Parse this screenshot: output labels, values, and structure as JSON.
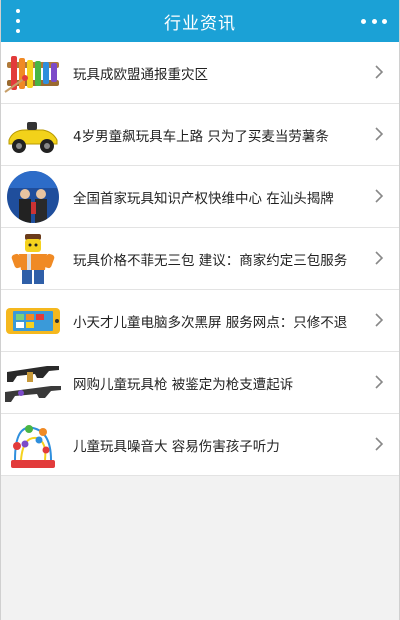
{
  "header": {
    "title": "行业资讯"
  },
  "icons": {
    "left": "vertical-dots-menu-icon",
    "right": "more-horizontal-icon",
    "chevron": "chevron-right-icon"
  },
  "colors": {
    "header_bg": "#1ba1d6",
    "page_bg": "#f2f2f2"
  },
  "news": {
    "items": [
      {
        "title": "玩具成欧盟通报重灾区",
        "thumb": "xylophone-toy-image"
      },
      {
        "title": "4岁男童飙玩具车上路 只为了买麦当劳薯条",
        "thumb": "toy-car-image"
      },
      {
        "title": "全国首家玩具知识产权快维中心 在汕头揭牌",
        "thumb": "ceremony-photo-image"
      },
      {
        "title": "玩具价格不菲无三包 建议：商家约定三包服务",
        "thumb": "lego-figure-image"
      },
      {
        "title": "小天才儿童电脑多次黑屏 服务网点：只修不退",
        "thumb": "kids-tablet-image"
      },
      {
        "title": "网购儿童玩具枪 被鉴定为枪支遭起诉",
        "thumb": "toy-guns-image"
      },
      {
        "title": "儿童玩具噪音大 容易伤害孩子听力",
        "thumb": "bead-maze-toy-image"
      }
    ]
  }
}
